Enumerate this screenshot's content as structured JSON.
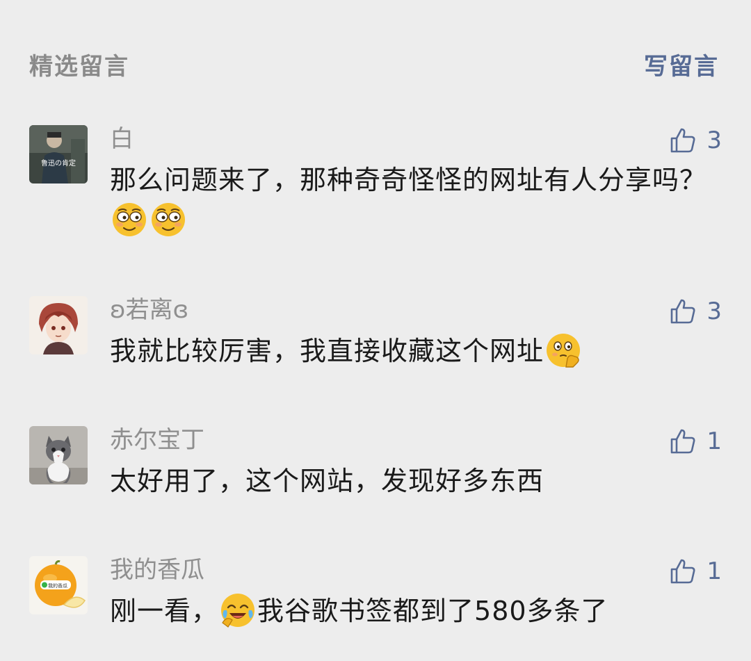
{
  "header": {
    "title": "精选留言",
    "write_label": "写留言"
  },
  "colors": {
    "background": "#ededed",
    "link": "#576b95",
    "nickname": "#8f8f8f",
    "text": "#1a1a1a"
  },
  "comments": [
    {
      "nickname": "白",
      "likes": "3",
      "text_before": "那么问题来了，那种奇奇怪怪的网址有人分享吗？",
      "emojis": [
        "flushed-face-icon",
        "flushed-face-icon"
      ],
      "avatar_icon": "person-photo-avatar",
      "avatar_caption": "鲁迅の肯定"
    },
    {
      "nickname": "ʚ若离ɞ",
      "likes": "3",
      "text_before": "我就比较厉害，我直接收藏这个网址",
      "emojis": [
        "thinking-face-icon"
      ],
      "avatar_icon": "anime-avatar"
    },
    {
      "nickname": "赤尔宝丁",
      "likes": "1",
      "text_before": "太好用了，这个网站，发现好多东西",
      "avatar_icon": "kitten-avatar"
    },
    {
      "nickname": "我的香瓜",
      "likes": "1",
      "text_before": "刚一看，",
      "text_after": "我谷歌书签都到了580多条了",
      "emojis": [
        "crying-laughing-face-icon"
      ],
      "avatar_icon": "melon-avatar",
      "avatar_caption": "我的香瓜"
    }
  ]
}
